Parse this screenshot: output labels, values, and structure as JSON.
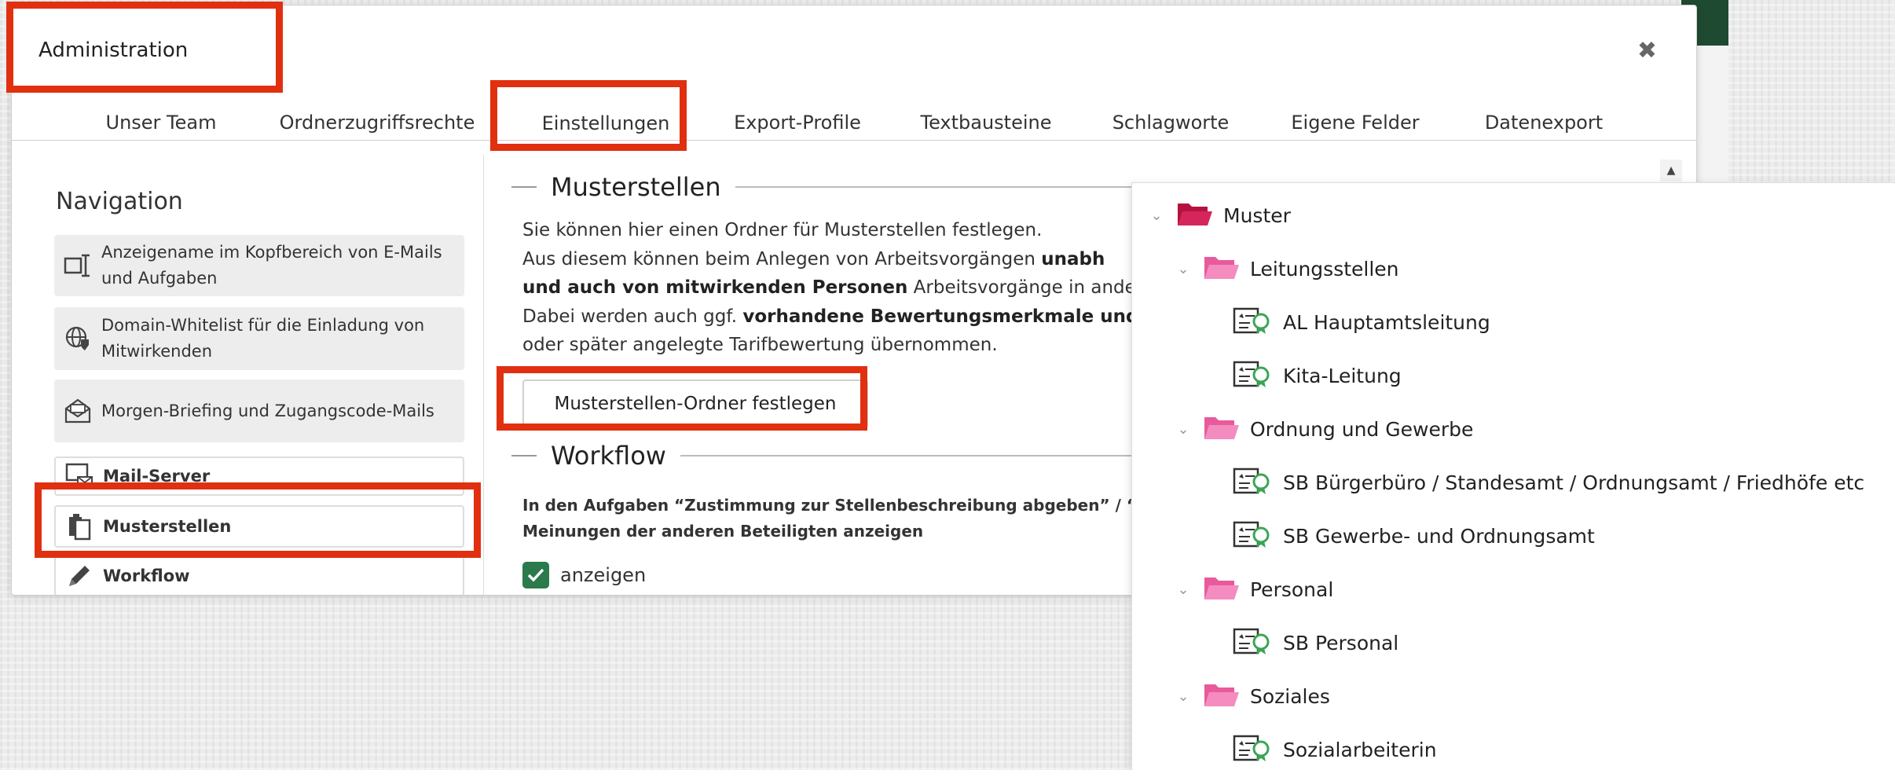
{
  "modal": {
    "title": "Administration",
    "close_icon": "close-icon"
  },
  "tabs": [
    {
      "label": "Unser Team"
    },
    {
      "label": "Ordnerzugriffsrechte"
    },
    {
      "label": "Einstellungen",
      "active": true
    },
    {
      "label": "Export-Profile"
    },
    {
      "label": "Textbausteine"
    },
    {
      "label": "Schlagworte"
    },
    {
      "label": "Eigene Felder"
    },
    {
      "label": "Datenexport"
    }
  ],
  "sidebar": {
    "heading": "Navigation",
    "items": [
      {
        "label": "Anzeigename im Kopfbereich von E-Mails und Aufgaben",
        "icon": "text-cursor-icon"
      },
      {
        "label": "Domain-Whitelist für die Einladung von Mitwirkenden",
        "icon": "globe-shield-icon"
      },
      {
        "label": "Morgen-Briefing und Zugangscode-Mails",
        "icon": "envelope-icon"
      },
      {
        "label": "Mail-Server",
        "icon": "mail-server-icon"
      },
      {
        "label": "Musterstellen",
        "icon": "clipboard-copy-icon",
        "selected": true
      },
      {
        "label": "Workflow",
        "icon": "pencil-icon"
      }
    ]
  },
  "content": {
    "musterstellen_title": "Musterstellen",
    "intro_line1": "Sie können hier einen Ordner für Musterstellen festlegen.",
    "intro_line2a": "Aus diesem können beim Anlegen von Arbeitsvorgängen ",
    "intro_line2b": "unabh",
    "intro_line3a": "und auch von mitwirkenden Personen",
    "intro_line3b": " Arbeitsvorgänge in ande",
    "intro_line4a": "Dabei werden auch ggf. ",
    "intro_line4b": "vorhandene Bewertungsmerkmale und",
    "intro_line5": "oder später angelegte Tarifbewertung übernommen.",
    "set_folder_button": "Musterstellen-Ordner festlegen",
    "workflow_title": "Workflow",
    "workflow_desc_line1": "In den Aufgaben “Zustimmung zur Stellenbeschreibung abgeben” / “Z",
    "workflow_desc_line2": "Meinungen der anderen Beteiligten anzeigen",
    "workflow_checkbox_label": "anzeigen",
    "workflow_checked": true
  },
  "tree": {
    "items": [
      {
        "label": "Muster",
        "type": "folder",
        "level": 0,
        "color": "#b5123f"
      },
      {
        "label": "Leitungsstellen",
        "type": "folder",
        "level": 1,
        "color": "#f06fae"
      },
      {
        "label": "AL Hauptamtsleitung",
        "type": "position",
        "level": 2
      },
      {
        "label": "Kita-Leitung",
        "type": "position",
        "level": 2
      },
      {
        "label": "Ordnung und Gewerbe",
        "type": "folder",
        "level": 1,
        "color": "#f06fae"
      },
      {
        "label": "SB Bürgerbüro / Standesamt / Ordnungsamt / Friedhöfe etc",
        "type": "position",
        "level": 2
      },
      {
        "label": "SB Gewerbe- und Ordnungsamt",
        "type": "position",
        "level": 2
      },
      {
        "label": "Personal",
        "type": "folder",
        "level": 1,
        "color": "#f06fae"
      },
      {
        "label": "SB Personal",
        "type": "position",
        "level": 2
      },
      {
        "label": "Soziales",
        "type": "folder",
        "level": 1,
        "color": "#f06fae"
      },
      {
        "label": "Sozialarbeiterin",
        "type": "position",
        "level": 2
      }
    ]
  },
  "colors": {
    "highlight": "#e03010",
    "brand_green": "#1f4a32",
    "checkbox_green": "#2a7a4c"
  }
}
